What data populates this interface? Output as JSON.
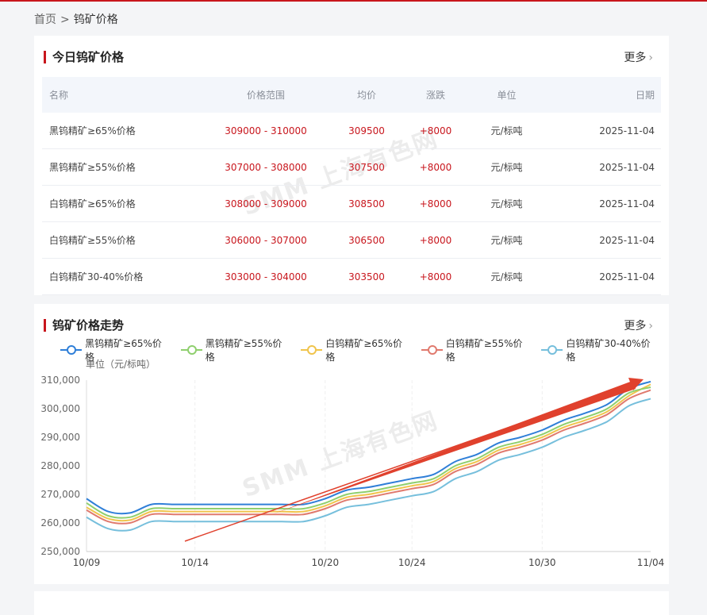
{
  "breadcrumb": {
    "home": "首页",
    "sep": ">",
    "current": "钨矿价格"
  },
  "prices": {
    "title": "今日钨矿价格",
    "more": "更多",
    "headers": [
      "名称",
      "价格范围",
      "均价",
      "涨跌",
      "单位",
      "日期"
    ],
    "rows": [
      {
        "name": "黑钨精矿≥65%价格",
        "range": "309000 - 310000",
        "avg": "309500",
        "change": "+8000",
        "unit": "元/标吨",
        "date": "2025-11-04"
      },
      {
        "name": "黑钨精矿≥55%价格",
        "range": "307000 - 308000",
        "avg": "307500",
        "change": "+8000",
        "unit": "元/标吨",
        "date": "2025-11-04"
      },
      {
        "name": "白钨精矿≥65%价格",
        "range": "308000 - 309000",
        "avg": "308500",
        "change": "+8000",
        "unit": "元/标吨",
        "date": "2025-11-04"
      },
      {
        "name": "白钨精矿≥55%价格",
        "range": "306000 - 307000",
        "avg": "306500",
        "change": "+8000",
        "unit": "元/标吨",
        "date": "2025-11-04"
      },
      {
        "name": "白钨精矿30-40%价格",
        "range": "303000 - 304000",
        "avg": "303500",
        "change": "+8000",
        "unit": "元/标吨",
        "date": "2025-11-04"
      }
    ]
  },
  "trend": {
    "title": "钨矿价格走势",
    "more": "更多",
    "unit_label": "单位（元/标吨）"
  },
  "watermark": "SMM 上海有色网",
  "colors": {
    "accent": "#c8161d",
    "up": "#c8161d"
  },
  "chart_data": {
    "type": "line",
    "x": [
      "10/09",
      "10/10",
      "10/11",
      "10/12",
      "10/13",
      "10/14",
      "10/15",
      "10/16",
      "10/17",
      "10/18",
      "10/19",
      "10/20",
      "10/21",
      "10/22",
      "10/23",
      "10/24",
      "10/25",
      "10/26",
      "10/27",
      "10/28",
      "10/29",
      "10/30",
      "10/31",
      "11/01",
      "11/02",
      "11/03",
      "11/04"
    ],
    "xticks": [
      "10/09",
      "10/14",
      "10/20",
      "10/24",
      "10/30",
      "11/04"
    ],
    "ylim": [
      250000,
      310000
    ],
    "yticks": [
      "250,000",
      "260,000",
      "270,000",
      "280,000",
      "290,000",
      "300,000",
      "310,000"
    ],
    "ylabel": "单位（元/标吨）",
    "legend_position": "top",
    "series": [
      {
        "name": "黑钨精矿≥65%价格",
        "color": "#2f7fd8",
        "values": [
          268500,
          264000,
          263500,
          266500,
          266500,
          266500,
          266500,
          266500,
          266500,
          266500,
          266500,
          268500,
          271500,
          272500,
          274000,
          275500,
          277000,
          281500,
          284000,
          288000,
          290000,
          292500,
          296000,
          298500,
          301500,
          307000,
          309500
        ]
      },
      {
        "name": "黑钨精矿≥55%价格",
        "color": "#8fcf6e",
        "values": [
          267000,
          262500,
          262000,
          265000,
          265000,
          265000,
          265000,
          265000,
          265000,
          265000,
          265000,
          267000,
          270000,
          271000,
          272500,
          274000,
          275500,
          280000,
          282500,
          286500,
          288500,
          291000,
          294500,
          297000,
          300000,
          305500,
          307500
        ]
      },
      {
        "name": "白钨精矿≥65%价格",
        "color": "#f0c44c",
        "values": [
          265500,
          261500,
          261000,
          264000,
          264000,
          264000,
          264000,
          264000,
          264000,
          264000,
          264000,
          266000,
          269000,
          270000,
          271500,
          273000,
          274500,
          279000,
          281500,
          285500,
          287500,
          290000,
          293500,
          296000,
          299000,
          304500,
          308500
        ]
      },
      {
        "name": "白钨精矿≥55%价格",
        "color": "#e07a6e",
        "values": [
          264500,
          260500,
          260000,
          263000,
          263000,
          263000,
          263000,
          263000,
          263000,
          263000,
          263000,
          265000,
          268000,
          269000,
          270500,
          272000,
          273500,
          278000,
          280500,
          284500,
          286500,
          289000,
          292500,
          295000,
          298000,
          303500,
          306500
        ]
      },
      {
        "name": "白钨精矿30-40%价格",
        "color": "#76bfdc",
        "values": [
          262000,
          258000,
          257500,
          260500,
          260500,
          260500,
          260500,
          260500,
          260500,
          260500,
          260500,
          262500,
          265500,
          266500,
          268000,
          269500,
          271000,
          275500,
          278000,
          282000,
          284000,
          286500,
          290000,
          292500,
          295500,
          301000,
          303500
        ]
      }
    ]
  }
}
